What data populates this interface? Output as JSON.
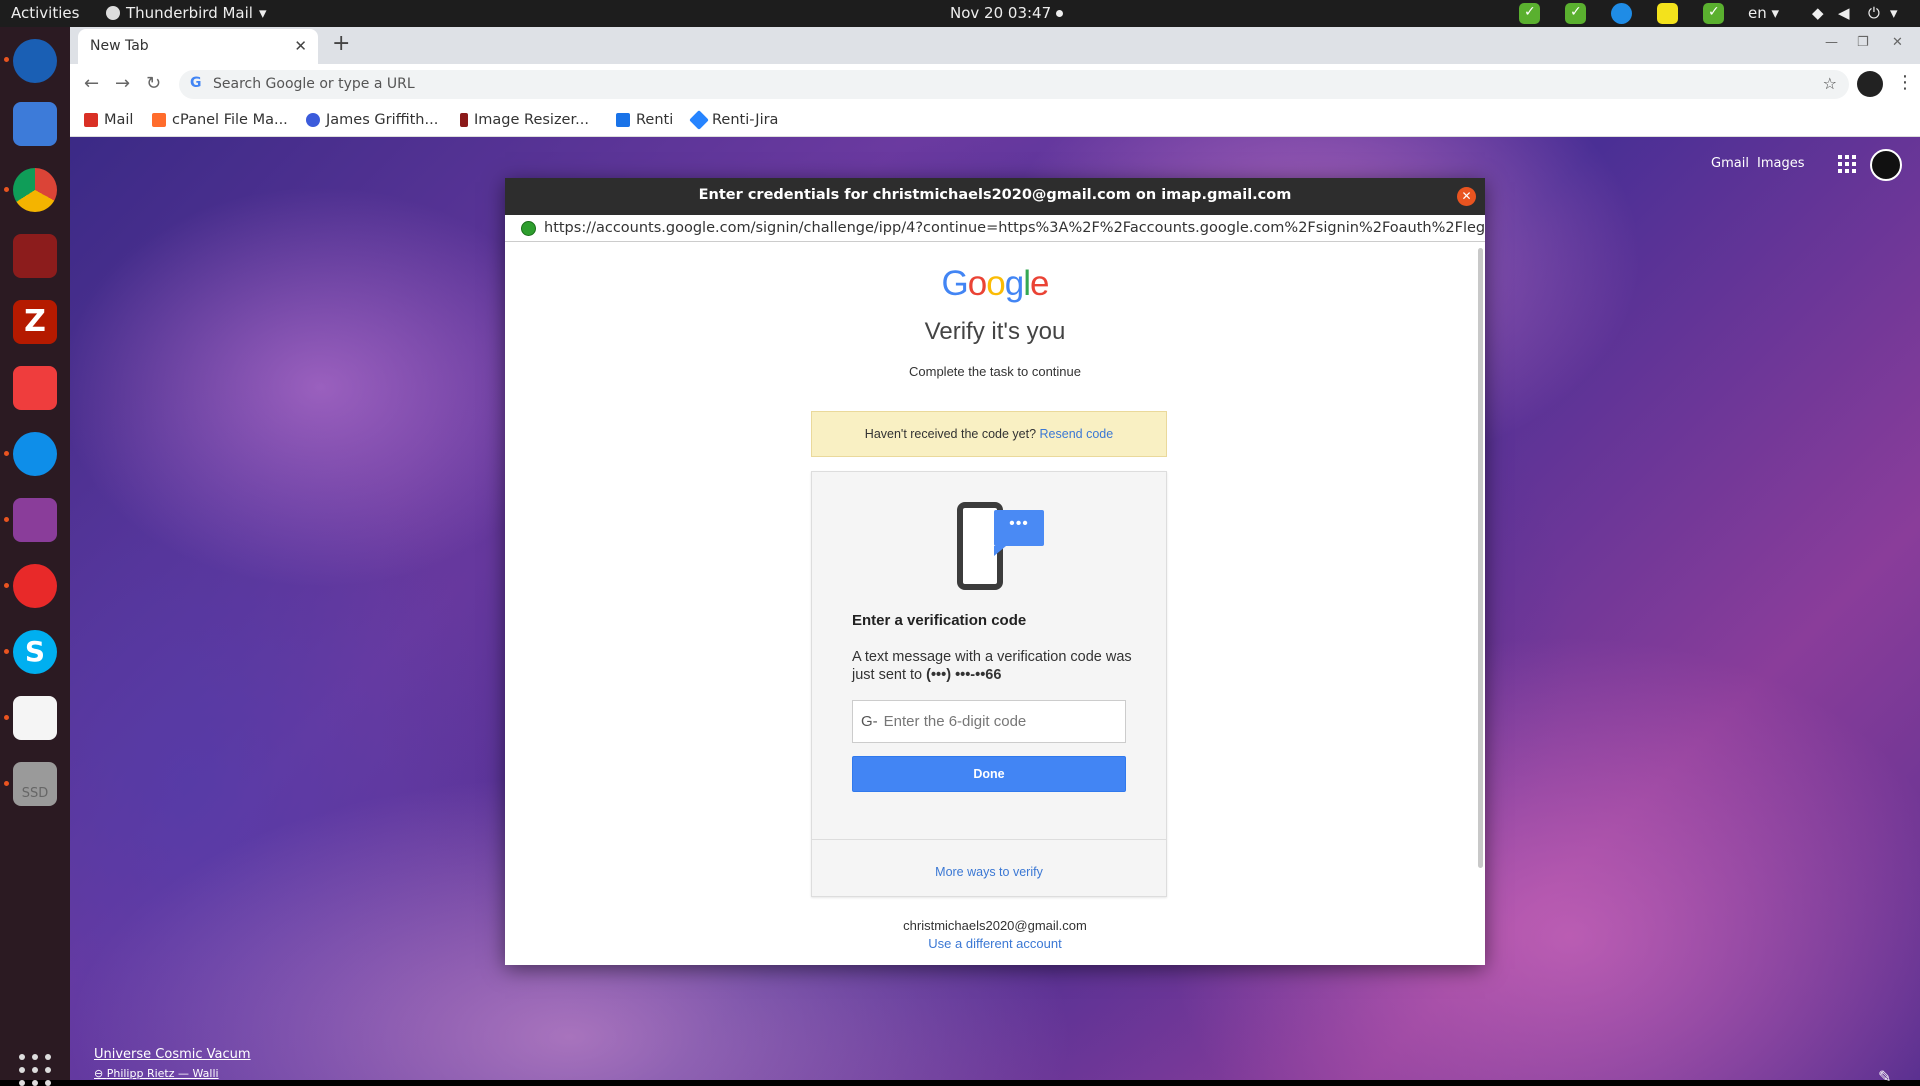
{
  "topbar": {
    "activities": "Activities",
    "app_name": "Thunderbird Mail",
    "app_arrow": "▾",
    "clock": "Nov 20  03:47",
    "language": "en",
    "language_arrow": "▾"
  },
  "browser": {
    "tab_title": "New Tab",
    "tab_close": "✕",
    "new_tab": "+",
    "omnibox_placeholder": "Search Google or type a URL",
    "bookmarks": [
      {
        "label": "Mail",
        "color": "#d93025"
      },
      {
        "label": "cPanel File Ma...",
        "color": "#ff6c2c"
      },
      {
        "label": "James Griffith...",
        "color": "#3b5bdb"
      },
      {
        "label": "Image Resizer...",
        "color": "#8b1a1a"
      },
      {
        "label": "Renti",
        "color": "#1a73e8"
      },
      {
        "label": "Renti-Jira",
        "color": "#2684ff"
      }
    ]
  },
  "page": {
    "gmail_link": "Gmail",
    "images_link": "Images",
    "credit_title": "Universe Cosmic Vacum",
    "credit_author": "Philipp Rietz — Walli"
  },
  "dialog": {
    "title": "Enter credentials for christmichaels2020@gmail.com on imap.gmail.com",
    "url": "https://accounts.google.com/signin/challenge/ipp/4?continue=https%3A%2F%2Faccounts.google.com%2Fsignin%2Foauth%2Fleg",
    "logo": {
      "G": "G",
      "o1": "o",
      "o2": "o",
      "g": "g",
      "l": "l",
      "e": "e"
    },
    "heading": "Verify it's you",
    "subheading": "Complete the task to continue",
    "notice_text": "Haven't received the code yet?",
    "resend_link": "Resend code",
    "bubble_dots": "•••",
    "card_title": "Enter a verification code",
    "card_text_pre": "A text message with a verification code was just sent to",
    "phone_masked": "(•••) •••-••66",
    "code_prefix": "G-",
    "code_placeholder": "Enter the 6-digit code",
    "done_button": "Done",
    "more_ways": "More ways to verify",
    "account_email": "christmichaels2020@gmail.com",
    "different_account": "Use a different account"
  }
}
